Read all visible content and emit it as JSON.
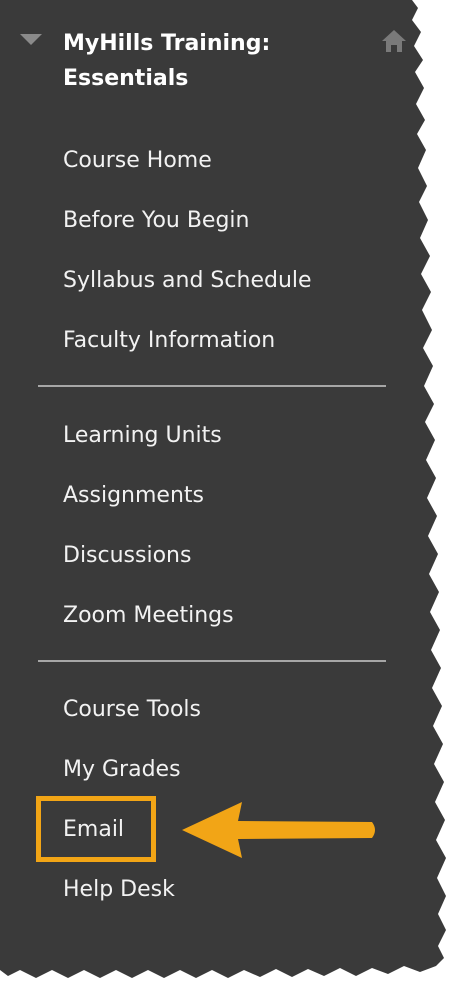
{
  "course": {
    "title": "MyHills Training: Essentials",
    "collapse_icon": "triangle-down-icon",
    "home_icon": "home-icon"
  },
  "menu": {
    "group1": [
      "Course Home",
      "Before You Begin",
      "Syllabus and Schedule",
      "Faculty Information"
    ],
    "group2": [
      "Learning Units",
      "Assignments",
      "Discussions",
      "Zoom Meetings"
    ],
    "group3": [
      "Course Tools",
      "My Grades",
      "Email",
      "Help Desk"
    ]
  },
  "annotation": {
    "highlighted_item": "Email",
    "callout_color": "#f2a516",
    "arrow_icon": "arrow-left-icon"
  },
  "colors": {
    "panel": "#3a3a3a",
    "text": "#f2f2f2",
    "divider": "#a6a6a6",
    "accent": "#f2a516"
  }
}
